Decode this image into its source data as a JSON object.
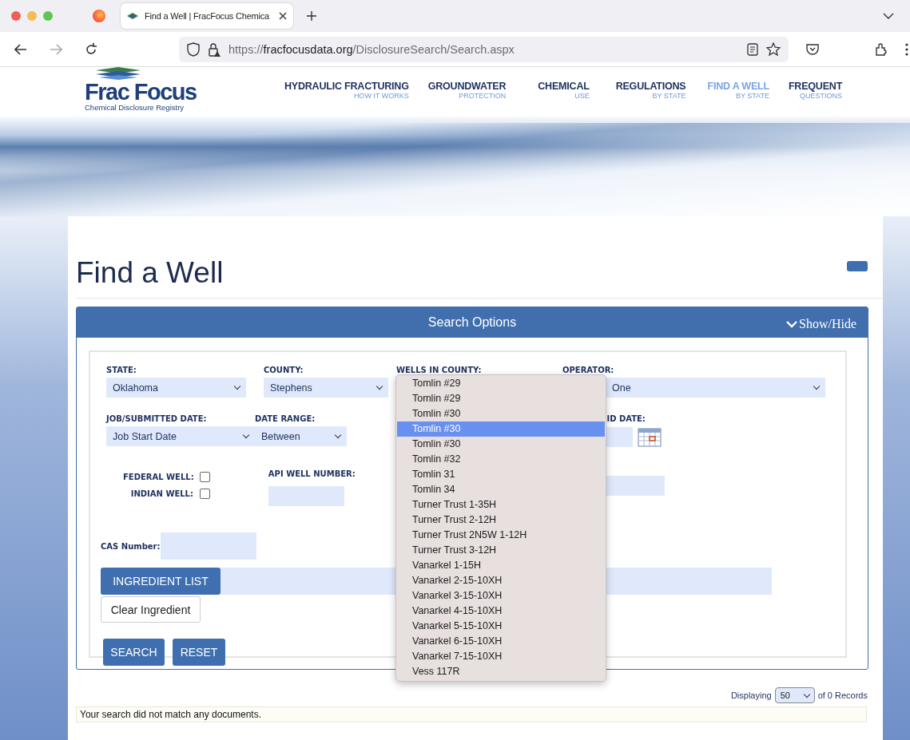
{
  "browser": {
    "tab_title": "Find a Well | FracFocus Chemica",
    "url_scheme": "https://",
    "url_host": "fracfocusdata.org",
    "url_path": "/DisclosureSearch/Search.aspx"
  },
  "site": {
    "logo_title": "Frac Focus",
    "logo_subtitle": "Chemical Disclosure Registry",
    "nav": [
      {
        "label": "HYDRAULIC FRACTURING",
        "sub": "HOW IT WORKS",
        "selected": false
      },
      {
        "label": "GROUNDWATER",
        "sub": "PROTECTION",
        "selected": false
      },
      {
        "label": "CHEMICAL",
        "sub": "USE",
        "selected": false
      },
      {
        "label": "REGULATIONS",
        "sub": "BY STATE",
        "selected": false
      },
      {
        "label": "FIND A WELL",
        "sub": "BY STATE",
        "selected": true
      },
      {
        "label": "FREQUENT",
        "sub": "QUESTIONS",
        "selected": false
      }
    ]
  },
  "page_title": "Find a Well",
  "search_options": {
    "title": "Search Options",
    "toggle": "Show/Hide"
  },
  "form": {
    "state": {
      "label": "STATE:",
      "value": "Oklahoma"
    },
    "county": {
      "label": "COUNTY:",
      "value": "Stephens"
    },
    "wells_in_county": {
      "label": "WELLS IN COUNTY:"
    },
    "operator": {
      "label": "OPERATOR:",
      "value": "One"
    },
    "job_date": {
      "label": "JOB/SUBMITTED DATE:",
      "value": "Job Start Date"
    },
    "date_range": {
      "label": "DATE RANGE:",
      "value": "Between"
    },
    "end_date": {
      "label": "ID DATE:"
    },
    "federal_well": {
      "label": "FEDERAL WELL:",
      "checked": false
    },
    "indian_well": {
      "label": "INDIAN WELL:",
      "checked": false
    },
    "api_well_number": {
      "label": "API WELL NUMBER:"
    },
    "cas_number": {
      "label": "CAS Number:"
    },
    "ingredient_list": "INGREDIENT LIST",
    "clear_ingredient": "Clear Ingredient",
    "search": "SEARCH",
    "reset": "RESET"
  },
  "wells_dropdown": [
    {
      "label": "Tomlin #29",
      "selected": false
    },
    {
      "label": "Tomlin #29",
      "selected": false
    },
    {
      "label": "Tomlin #30",
      "selected": false
    },
    {
      "label": "Tomlin #30",
      "selected": true
    },
    {
      "label": "Tomlin #30",
      "selected": false
    },
    {
      "label": "Tomlin #32",
      "selected": false
    },
    {
      "label": "Tomlin 31",
      "selected": false
    },
    {
      "label": "Tomlin 34",
      "selected": false
    },
    {
      "label": "Turner Trust 1-35H",
      "selected": false
    },
    {
      "label": "Turner Trust 2-12H",
      "selected": false
    },
    {
      "label": "Turner Trust 2N5W 1-12H",
      "selected": false
    },
    {
      "label": "Turner Trust 3-12H",
      "selected": false
    },
    {
      "label": "Vanarkel 1-15H",
      "selected": false
    },
    {
      "label": "Vanarkel 2-15-10XH",
      "selected": false
    },
    {
      "label": "Vanarkel 3-15-10XH",
      "selected": false
    },
    {
      "label": "Vanarkel 4-15-10XH",
      "selected": false
    },
    {
      "label": "Vanarkel 5-15-10XH",
      "selected": false
    },
    {
      "label": "Vanarkel 6-15-10XH",
      "selected": false
    },
    {
      "label": "Vanarkel 7-15-10XH",
      "selected": false
    },
    {
      "label": "Vess 117R",
      "selected": false
    }
  ],
  "results": {
    "displaying": "Displaying",
    "page_size": "50",
    "records": "of 0 Records",
    "message": "Your search did not match any documents."
  }
}
